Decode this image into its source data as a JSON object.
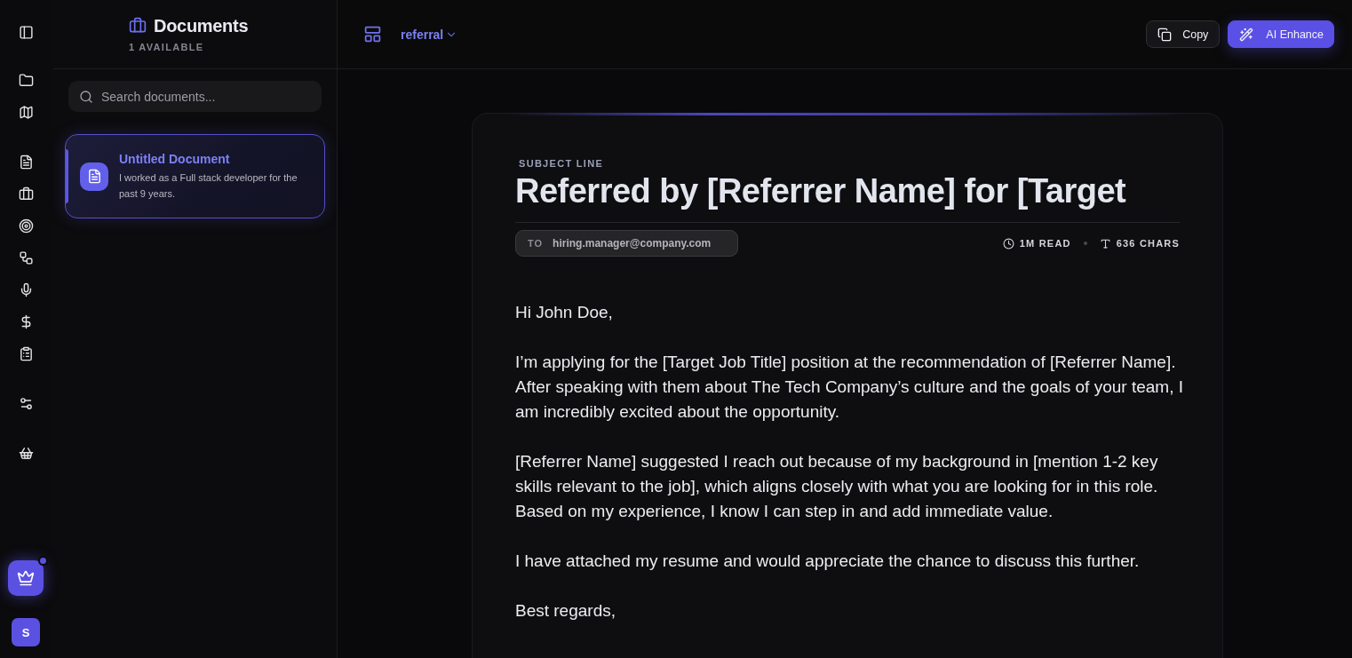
{
  "rail": {
    "upgrade_badge": true,
    "avatar": "S"
  },
  "sidebar": {
    "title": "Documents",
    "count": "1 AVAILABLE",
    "search": {
      "placeholder": "Search documents..."
    },
    "documents": [
      {
        "title": "Untitled Document",
        "snippet": "I worked as a Full stack developer for the past 9 years.",
        "selected": true
      }
    ]
  },
  "topbar": {
    "template": "referral",
    "buttons": [
      {
        "kind": "copy",
        "label": "Copy"
      },
      {
        "kind": "enhance",
        "label": "AI Enhance"
      }
    ]
  },
  "document": {
    "subject_label": "SUBJECT LINE",
    "subject": "Referred by [Referrer Name] for [Target",
    "to_label": "TO",
    "to": "hiring.manager@company.com",
    "read_time": "1M READ",
    "chars": "636 CHARS",
    "body": [
      "Hi John Doe,",
      "I’m applying for the [Target Job Title] position at the recommendation of [Referrer Name]. After speaking with them about The Tech Company’s culture and the goals of your team, I am incredibly excited about the opportunity.",
      "[Referrer Name] suggested I reach out because of my background in [mention 1-2 key skills relevant to the job], which aligns closely with what you are looking for in this role. Based on my experience, I know I can step in and add immediate value.",
      "I have attached my resume and would appreciate the chance to discuss this further.",
      "Best regards,"
    ]
  }
}
